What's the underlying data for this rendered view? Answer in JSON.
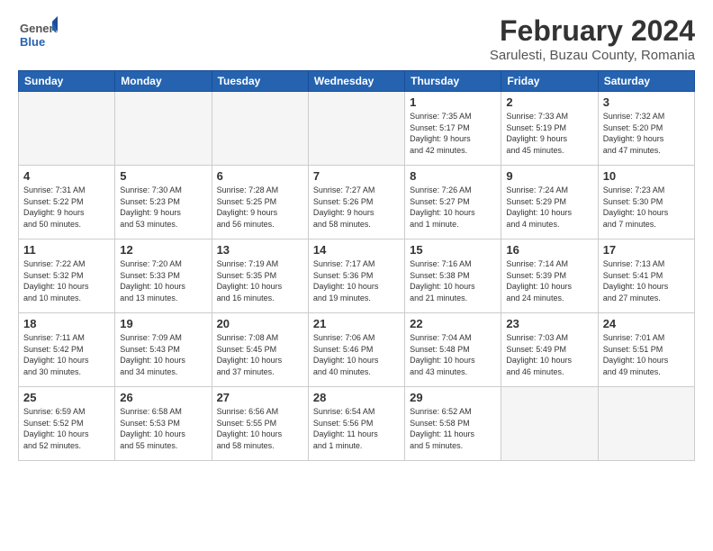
{
  "header": {
    "logo_general": "General",
    "logo_blue": "Blue",
    "month": "February 2024",
    "location": "Sarulesti, Buzau County, Romania"
  },
  "days_of_week": [
    "Sunday",
    "Monday",
    "Tuesday",
    "Wednesday",
    "Thursday",
    "Friday",
    "Saturday"
  ],
  "weeks": [
    [
      {
        "day": "",
        "info": ""
      },
      {
        "day": "",
        "info": ""
      },
      {
        "day": "",
        "info": ""
      },
      {
        "day": "",
        "info": ""
      },
      {
        "day": "1",
        "info": "Sunrise: 7:35 AM\nSunset: 5:17 PM\nDaylight: 9 hours\nand 42 minutes."
      },
      {
        "day": "2",
        "info": "Sunrise: 7:33 AM\nSunset: 5:19 PM\nDaylight: 9 hours\nand 45 minutes."
      },
      {
        "day": "3",
        "info": "Sunrise: 7:32 AM\nSunset: 5:20 PM\nDaylight: 9 hours\nand 47 minutes."
      }
    ],
    [
      {
        "day": "4",
        "info": "Sunrise: 7:31 AM\nSunset: 5:22 PM\nDaylight: 9 hours\nand 50 minutes."
      },
      {
        "day": "5",
        "info": "Sunrise: 7:30 AM\nSunset: 5:23 PM\nDaylight: 9 hours\nand 53 minutes."
      },
      {
        "day": "6",
        "info": "Sunrise: 7:28 AM\nSunset: 5:25 PM\nDaylight: 9 hours\nand 56 minutes."
      },
      {
        "day": "7",
        "info": "Sunrise: 7:27 AM\nSunset: 5:26 PM\nDaylight: 9 hours\nand 58 minutes."
      },
      {
        "day": "8",
        "info": "Sunrise: 7:26 AM\nSunset: 5:27 PM\nDaylight: 10 hours\nand 1 minute."
      },
      {
        "day": "9",
        "info": "Sunrise: 7:24 AM\nSunset: 5:29 PM\nDaylight: 10 hours\nand 4 minutes."
      },
      {
        "day": "10",
        "info": "Sunrise: 7:23 AM\nSunset: 5:30 PM\nDaylight: 10 hours\nand 7 minutes."
      }
    ],
    [
      {
        "day": "11",
        "info": "Sunrise: 7:22 AM\nSunset: 5:32 PM\nDaylight: 10 hours\nand 10 minutes."
      },
      {
        "day": "12",
        "info": "Sunrise: 7:20 AM\nSunset: 5:33 PM\nDaylight: 10 hours\nand 13 minutes."
      },
      {
        "day": "13",
        "info": "Sunrise: 7:19 AM\nSunset: 5:35 PM\nDaylight: 10 hours\nand 16 minutes."
      },
      {
        "day": "14",
        "info": "Sunrise: 7:17 AM\nSunset: 5:36 PM\nDaylight: 10 hours\nand 19 minutes."
      },
      {
        "day": "15",
        "info": "Sunrise: 7:16 AM\nSunset: 5:38 PM\nDaylight: 10 hours\nand 21 minutes."
      },
      {
        "day": "16",
        "info": "Sunrise: 7:14 AM\nSunset: 5:39 PM\nDaylight: 10 hours\nand 24 minutes."
      },
      {
        "day": "17",
        "info": "Sunrise: 7:13 AM\nSunset: 5:41 PM\nDaylight: 10 hours\nand 27 minutes."
      }
    ],
    [
      {
        "day": "18",
        "info": "Sunrise: 7:11 AM\nSunset: 5:42 PM\nDaylight: 10 hours\nand 30 minutes."
      },
      {
        "day": "19",
        "info": "Sunrise: 7:09 AM\nSunset: 5:43 PM\nDaylight: 10 hours\nand 34 minutes."
      },
      {
        "day": "20",
        "info": "Sunrise: 7:08 AM\nSunset: 5:45 PM\nDaylight: 10 hours\nand 37 minutes."
      },
      {
        "day": "21",
        "info": "Sunrise: 7:06 AM\nSunset: 5:46 PM\nDaylight: 10 hours\nand 40 minutes."
      },
      {
        "day": "22",
        "info": "Sunrise: 7:04 AM\nSunset: 5:48 PM\nDaylight: 10 hours\nand 43 minutes."
      },
      {
        "day": "23",
        "info": "Sunrise: 7:03 AM\nSunset: 5:49 PM\nDaylight: 10 hours\nand 46 minutes."
      },
      {
        "day": "24",
        "info": "Sunrise: 7:01 AM\nSunset: 5:51 PM\nDaylight: 10 hours\nand 49 minutes."
      }
    ],
    [
      {
        "day": "25",
        "info": "Sunrise: 6:59 AM\nSunset: 5:52 PM\nDaylight: 10 hours\nand 52 minutes."
      },
      {
        "day": "26",
        "info": "Sunrise: 6:58 AM\nSunset: 5:53 PM\nDaylight: 10 hours\nand 55 minutes."
      },
      {
        "day": "27",
        "info": "Sunrise: 6:56 AM\nSunset: 5:55 PM\nDaylight: 10 hours\nand 58 minutes."
      },
      {
        "day": "28",
        "info": "Sunrise: 6:54 AM\nSunset: 5:56 PM\nDaylight: 11 hours\nand 1 minute."
      },
      {
        "day": "29",
        "info": "Sunrise: 6:52 AM\nSunset: 5:58 PM\nDaylight: 11 hours\nand 5 minutes."
      },
      {
        "day": "",
        "info": ""
      },
      {
        "day": "",
        "info": ""
      }
    ]
  ]
}
